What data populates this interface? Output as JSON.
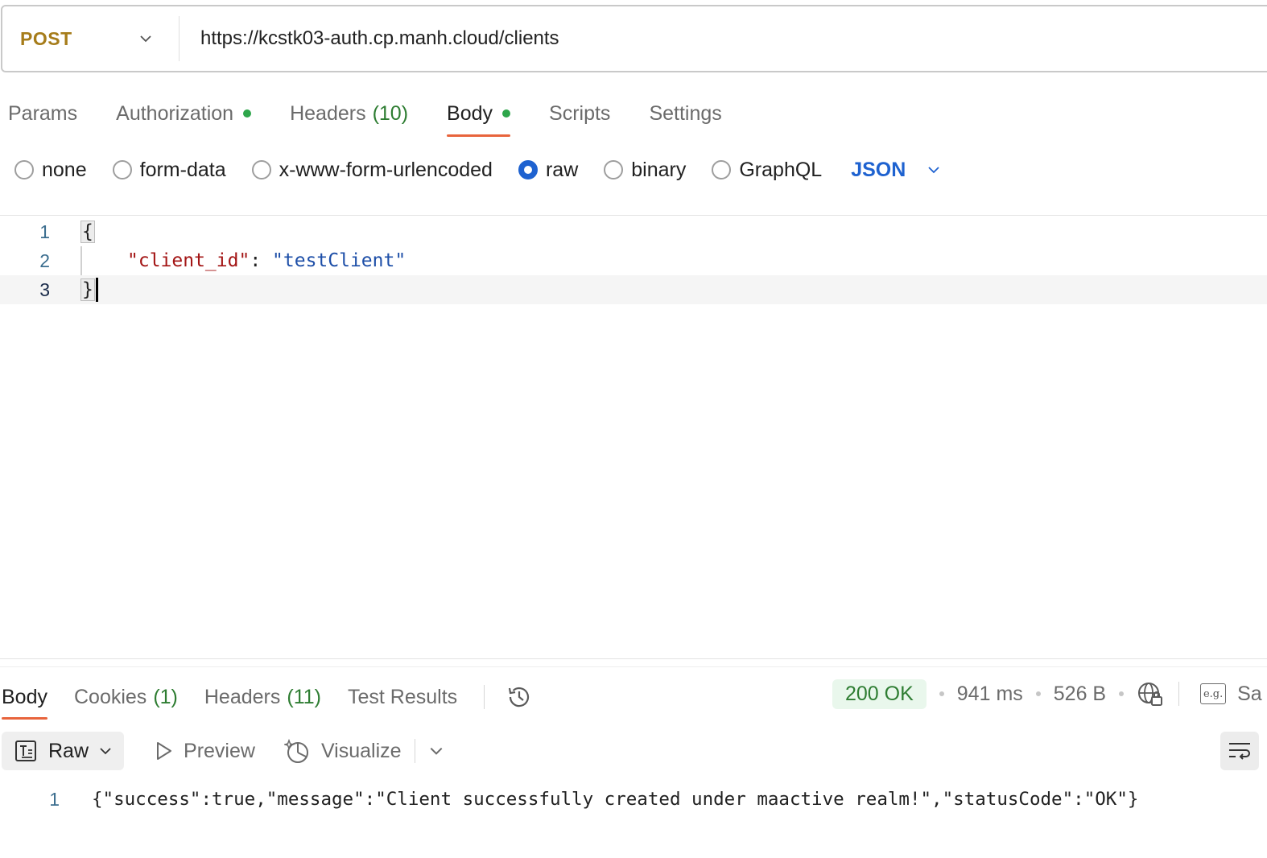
{
  "request": {
    "method": "POST",
    "url": "https://kcstk03-auth.cp.manh.cloud/clients"
  },
  "request_tabs": [
    {
      "label": "Params"
    },
    {
      "label": "Authorization"
    },
    {
      "label": "Headers",
      "count": "(10)"
    },
    {
      "label": "Body"
    },
    {
      "label": "Scripts"
    },
    {
      "label": "Settings"
    }
  ],
  "body_types": {
    "options": [
      "none",
      "form-data",
      "x-www-form-urlencoded",
      "raw",
      "binary",
      "GraphQL"
    ],
    "selected": "raw",
    "format": "JSON"
  },
  "editor": {
    "line_numbers": [
      "1",
      "2",
      "3"
    ],
    "open_brace": "{",
    "key": "\"client_id\"",
    "colon": ": ",
    "value": "\"testClient\"",
    "close_brace": "}"
  },
  "response_tabs": [
    {
      "label": "Body"
    },
    {
      "label": "Cookies",
      "count": "(1)"
    },
    {
      "label": "Headers",
      "count": "(11)"
    },
    {
      "label": "Test Results"
    }
  ],
  "response_meta": {
    "status": "200 OK",
    "time": "941 ms",
    "size": "526 B",
    "save_label": "Sa"
  },
  "view_toolbar": {
    "raw_label": "Raw",
    "preview_label": "Preview",
    "visualize_label": "Visualize"
  },
  "response_body": {
    "line_number": "1",
    "content": "{\"success\":true,\"message\":\"Client successfully created under maactive realm!\",\"statusCode\":\"OK\"}"
  },
  "colors": {
    "method": "#a67c1a",
    "accent_tab": "#e8643c",
    "radio_selected": "#1e62d0",
    "status_ok": "#2e7d32",
    "json_key": "#a31515",
    "json_string": "#1e4fa8"
  }
}
